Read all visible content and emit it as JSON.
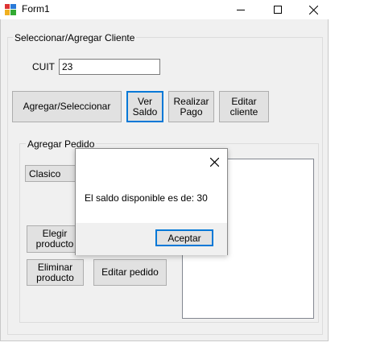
{
  "window": {
    "title": "Form1",
    "minimize_icon": "minimize-icon",
    "maximize_icon": "maximize-icon",
    "close_icon": "close-icon"
  },
  "cliente_group": {
    "label": "Seleccionar/Agregar Cliente",
    "cuit_label": "CUIT",
    "cuit_value": "23",
    "buttons": {
      "agregar_seleccionar": "Agregar/Seleccionar",
      "ver_saldo_line1": "Ver",
      "ver_saldo_line2": "Saldo",
      "realizar_pago_line1": "Realizar",
      "realizar_pago_line2": "Pago",
      "editar_cliente_line1": "Editar",
      "editar_cliente_line2": "cliente"
    }
  },
  "pedido_group": {
    "label": "Agregar Pedido",
    "combo_value": "Clasico",
    "buttons": {
      "elegir_producto_line1": "Elegir",
      "elegir_producto_line2": "producto",
      "eliminar_producto_line1": "Eliminar",
      "eliminar_producto_line2": "producto",
      "editar_pedido": "Editar pedido"
    }
  },
  "message_box": {
    "text": "El saldo disponible es de: 30",
    "ok_label": "Aceptar",
    "close_icon": "close-icon"
  }
}
